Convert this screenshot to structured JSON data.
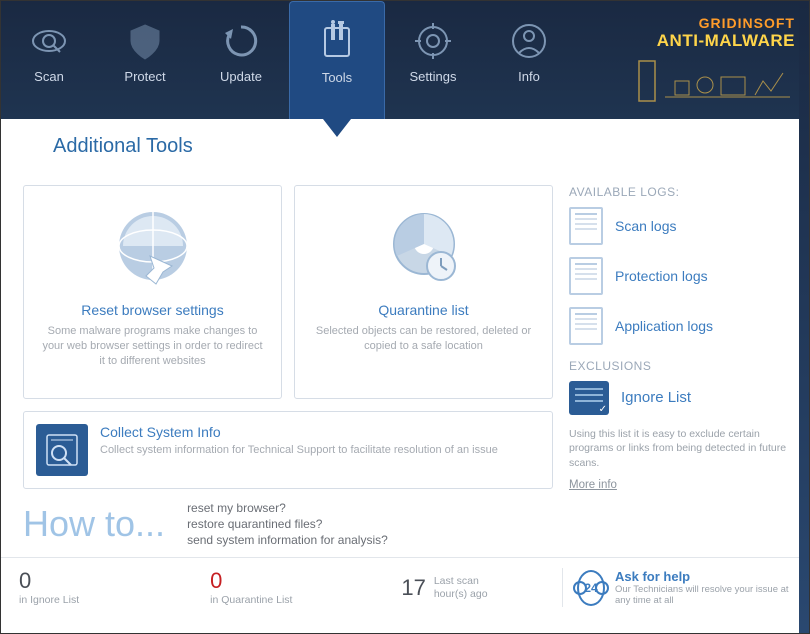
{
  "brand": {
    "top": "GRIDINSOFT",
    "bottom": "ANTI-MALWARE"
  },
  "tabs": [
    {
      "label": "Scan",
      "icon": "scan-icon"
    },
    {
      "label": "Protect",
      "icon": "shield-icon"
    },
    {
      "label": "Update",
      "icon": "refresh-icon"
    },
    {
      "label": "Tools",
      "icon": "tools-icon",
      "active": true
    },
    {
      "label": "Settings",
      "icon": "gear-icon"
    },
    {
      "label": "Info",
      "icon": "user-icon"
    }
  ],
  "page_title": "Additional Tools",
  "cards": {
    "reset": {
      "title": "Reset browser settings",
      "desc": "Some malware programs make changes to your web browser settings in order to redirect it to different websites"
    },
    "quarantine": {
      "title": "Quarantine list",
      "desc": "Selected objects can be restored, deleted or copied to a safe location"
    },
    "sysinfo": {
      "title": "Collect System Info",
      "desc": "Collect system information for Technical Support to facilitate resolution of an issue"
    }
  },
  "howto": {
    "label": "How to...",
    "items": [
      "reset my browser?",
      "restore quarantined files?",
      "send system information for analysis?"
    ]
  },
  "logs": {
    "heading": "AVAILABLE LOGS:",
    "items": [
      {
        "label": "Scan logs",
        "icon": "scan-log-icon"
      },
      {
        "label": "Protection logs",
        "icon": "protection-log-icon"
      },
      {
        "label": "Application logs",
        "icon": "app-log-icon"
      }
    ]
  },
  "exclusions": {
    "heading": "EXCLUSIONS",
    "item_label": "Ignore List",
    "desc": "Using this list it is easy to exclude certain programs or links from being detected in future scans.",
    "more": "More info"
  },
  "footer": {
    "ignore": {
      "count": "0",
      "label": "in Ignore List"
    },
    "quarantine": {
      "count": "0",
      "label": "in Quarantine List"
    },
    "lastscan": {
      "count": "17",
      "line1": "Last scan",
      "line2": "hour(s) ago"
    },
    "help": {
      "title": "Ask for help",
      "desc": "Our Technicians will resolve your issue at any time at all",
      "badge": "24"
    }
  }
}
